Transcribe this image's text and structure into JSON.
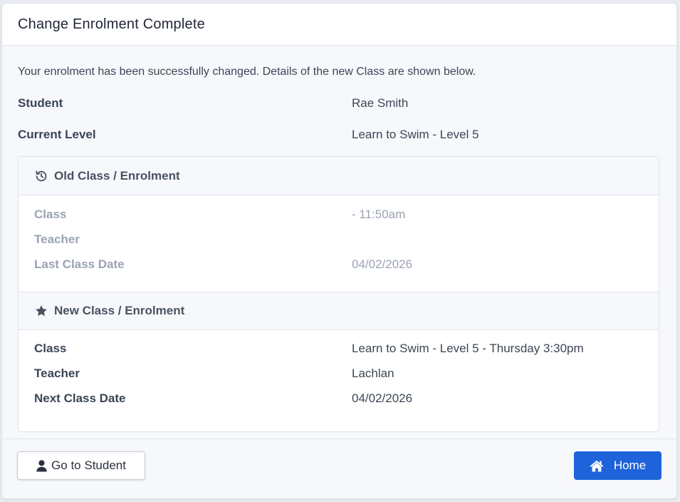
{
  "header": {
    "title": "Change Enrolment Complete"
  },
  "intro": "Your enrolment has been successfully changed. Details of the new Class are shown below.",
  "student": {
    "label": "Student",
    "value": "Rae Smith"
  },
  "current_level": {
    "label": "Current Level",
    "value": "Learn to Swim - Level 5"
  },
  "old_enrolment": {
    "heading": "Old Class / Enrolment",
    "icon": "history-icon",
    "class_label": "Class",
    "class_value": "- 11:50am",
    "teacher_label": "Teacher",
    "teacher_value": "",
    "date_label": "Last Class Date",
    "date_value": "04/02/2026"
  },
  "new_enrolment": {
    "heading": "New Class / Enrolment",
    "icon": "star-icon",
    "class_label": "Class",
    "class_value": "Learn to Swim - Level 5 - Thursday 3:30pm",
    "teacher_label": "Teacher",
    "teacher_value": "Lachlan",
    "date_label": "Next Class Date",
    "date_value": "04/02/2026"
  },
  "footer": {
    "student_button": "Go to Student",
    "student_button_icon": "user-icon",
    "home_button": "Home",
    "home_button_icon": "home-icon"
  },
  "colors": {
    "primary": "#1e63d9",
    "muted_text": "#9aa3b2"
  }
}
